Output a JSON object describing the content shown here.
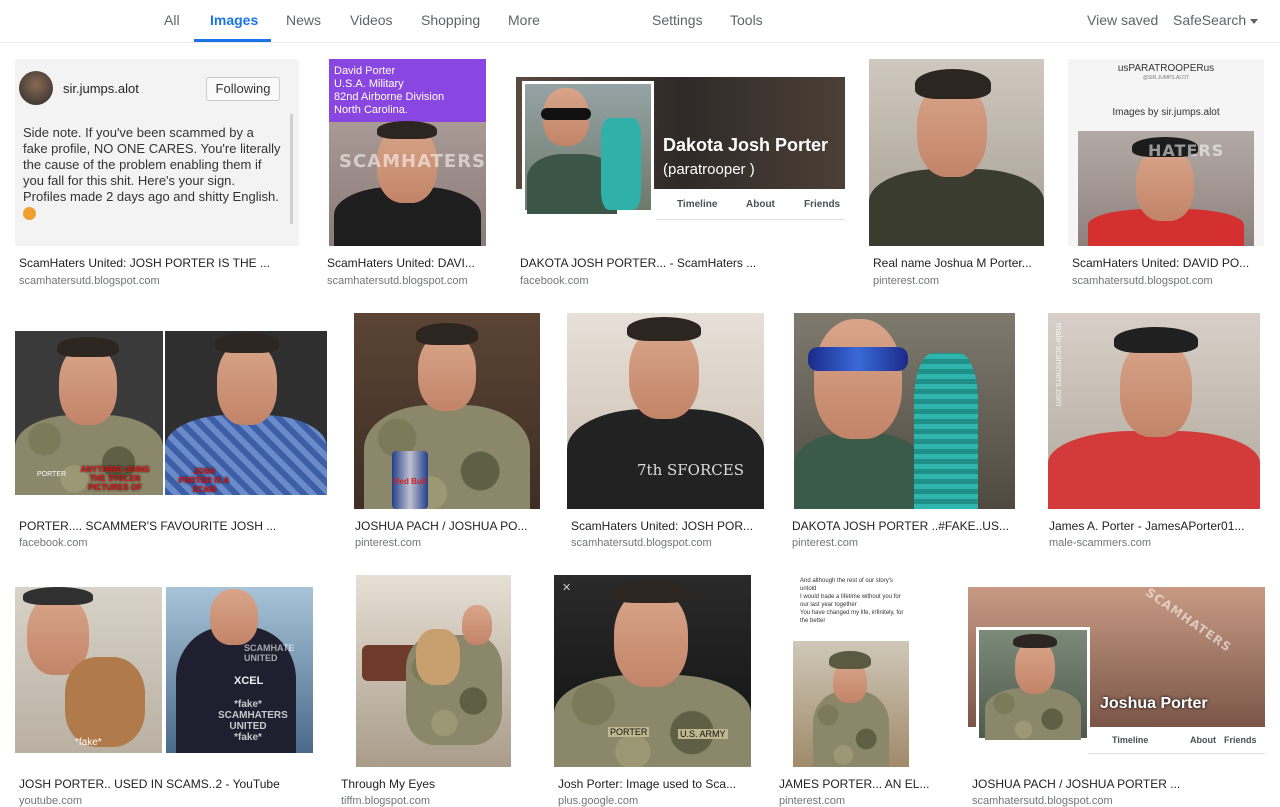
{
  "nav": {
    "tabs": [
      "All",
      "Images",
      "News",
      "Videos",
      "Shopping",
      "More"
    ],
    "active_tab": "Images",
    "settings": "Settings",
    "tools": "Tools",
    "view_saved": "View saved",
    "safesearch": "SafeSearch"
  },
  "colors": {
    "accent": "#1a73e8",
    "caption": "#222222",
    "source": "#70757a"
  },
  "results": [
    {
      "caption": "ScamHaters United: JOSH PORTER IS THE ...",
      "source": "scamhatersutd.blogspot.com",
      "ig": {
        "user": "sir.jumps.alot",
        "follow_btn": "Following",
        "lines": [
          "Side note. If you've been scammed by a",
          "fake profile, NO ONE CARES. You're literally",
          "the cause of the problem enabling them if",
          "you fall for this shit. Here's your sign.",
          "Profiles made 2 days ago and shitty English."
        ]
      }
    },
    {
      "caption": "ScamHaters United: DAVI...",
      "source": "scamhatersutd.blogspot.com",
      "overlay_lines": [
        "David Porter",
        "U.S.A. Military",
        "82nd Airborne Division",
        "North Carolina."
      ],
      "wm": "SCAMHATERS"
    },
    {
      "caption": "DAKOTA JOSH PORTER... - ScamHaters ...",
      "source": "facebook.com",
      "fb": {
        "name": "Dakota Josh Porter",
        "sub": "(paratrooper )",
        "tabs": [
          "Timeline",
          "About",
          "Friends"
        ]
      }
    },
    {
      "caption": "Real name Joshua M Porter...",
      "source": "pinterest.com"
    },
    {
      "caption": "ScamHaters United: DAVID PO...",
      "source": "scamhatersutd.blogspot.com",
      "header": "usPARATROOPERus",
      "sub": "@SIR.JUMPS.ALOT",
      "images_by": "Images by sir.jumps.alot",
      "wm": "HATERS"
    },
    {
      "caption": "PORTER.... SCAMMER'S FAVOURITE JOSH ...",
      "source": "facebook.com",
      "labels": [
        "ANYTHING USING THE STOLEN PICTURES OF",
        "JOSH PORTER IS A SCAM"
      ],
      "name_tag": "PORTER"
    },
    {
      "caption": "JOSHUA PACH / JOSHUA PO...",
      "source": "pinterest.com",
      "can": "Red Bull"
    },
    {
      "caption": "ScamHaters United: JOSH POR...",
      "source": "scamhatersutd.blogspot.com",
      "shirt_text": "7th SFORCES"
    },
    {
      "caption": "DAKOTA JOSH PORTER ..#FAKE..US...",
      "source": "pinterest.com"
    },
    {
      "caption": "James A. Porter - JamesAPorter01...",
      "source": "male-scammers.com",
      "wm_vertical": "male-scammers.com"
    },
    {
      "caption": "JOSH PORTER.. USED IN SCAMS..2 - YouTube",
      "source": "youtube.com",
      "labels": [
        "*fake*",
        "SCAMHATE UNITED",
        "XCEL",
        "*fake* SCAMHATERS UNITED *fake*"
      ]
    },
    {
      "caption": "Through My Eyes",
      "source": "tiffm.blogspot.com"
    },
    {
      "caption": "Josh Porter: Image used to Sca...",
      "source": "plus.google.com",
      "tags": [
        "PORTER",
        "U.S. ARMY"
      ]
    },
    {
      "caption": "JAMES PORTER... AN EL...",
      "source": "pinterest.com",
      "note_lines": [
        "And although the rest of our story's",
        "untold",
        "I would trade a lifetime without you for",
        "our last year together",
        "You have changed my life, infinitely, for",
        "the better"
      ]
    },
    {
      "caption": "JOSHUA PACH / JOSHUA PORTER ...",
      "source": "scamhatersutd.blogspot.com",
      "fb": {
        "name": "Joshua Porter",
        "tabs": [
          "Timeline",
          "About",
          "Friends"
        ]
      },
      "wm": "SCAMHATERS"
    }
  ]
}
